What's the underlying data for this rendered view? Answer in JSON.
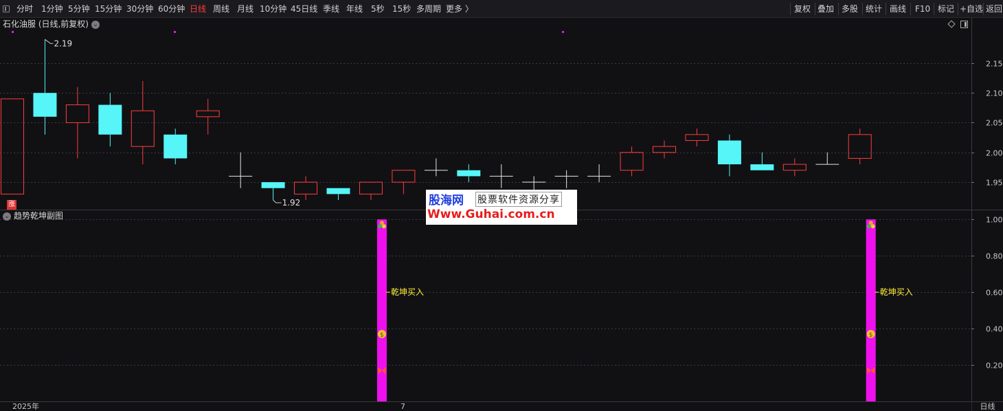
{
  "toolbar": {
    "periods": [
      "分时",
      "1分钟",
      "5分钟",
      "15分钟",
      "30分钟",
      "60分钟",
      "日线",
      "周线",
      "月线",
      "10分钟",
      "45日线",
      "季线",
      "年线",
      "5秒",
      "15秒",
      "多周期",
      "更多 〉"
    ],
    "active_period": "日线",
    "actions": [
      "复权",
      "叠加",
      "多股",
      "统计",
      "画线",
      "F10",
      "标记",
      "+自选",
      "返回"
    ]
  },
  "main_panel": {
    "title": "石化油服 (日线,前复权)",
    "high_label": "2.19",
    "low_label": "1.92",
    "zhang_badge": "涨",
    "y_axis_ticks": [
      "2.15",
      "2.10",
      "2.05",
      "2.00",
      "1.95"
    ]
  },
  "sub_panel": {
    "title": "趋势乾坤副图",
    "y_axis_ticks": [
      "1.00",
      "0.80",
      "0.60",
      "0.40",
      "0.20"
    ],
    "signal_label": "乾坤买入"
  },
  "watermark": {
    "brand": "股海网",
    "tagline": "股票软件资源分享",
    "url": "Www.Guhai.com.cn"
  },
  "bottom_axis": {
    "year_label": "2025年",
    "month_label": "7",
    "period_label": "日线"
  },
  "colors": {
    "up": "#ff3c3c",
    "down": "#55f5f8",
    "doji": "#e6e6e6",
    "signal_bar": "#ee11ee",
    "signal_text": "#ffee33",
    "grid": "#3a3a44"
  },
  "chart_data": {
    "type": "candlestick",
    "candles": [
      {
        "o": 1.93,
        "c": 2.09,
        "h": 2.09,
        "l": 1.93
      },
      {
        "o": 2.1,
        "c": 2.06,
        "h": 2.19,
        "l": 2.03
      },
      {
        "o": 2.05,
        "c": 2.08,
        "h": 2.11,
        "l": 1.99
      },
      {
        "o": 2.08,
        "c": 2.03,
        "h": 2.1,
        "l": 2.01
      },
      {
        "o": 2.01,
        "c": 2.07,
        "h": 2.12,
        "l": 1.98
      },
      {
        "o": 2.03,
        "c": 1.99,
        "h": 2.04,
        "l": 1.98
      },
      {
        "o": 2.06,
        "c": 2.07,
        "h": 2.09,
        "l": 2.03
      },
      {
        "o": 1.96,
        "c": 1.96,
        "h": 2.0,
        "l": 1.94
      },
      {
        "o": 1.95,
        "c": 1.94,
        "h": 1.95,
        "l": 1.92
      },
      {
        "o": 1.93,
        "c": 1.95,
        "h": 1.96,
        "l": 1.92
      },
      {
        "o": 1.94,
        "c": 1.93,
        "h": 1.94,
        "l": 1.92
      },
      {
        "o": 1.93,
        "c": 1.95,
        "h": 1.95,
        "l": 1.92
      },
      {
        "o": 1.95,
        "c": 1.97,
        "h": 1.97,
        "l": 1.93
      },
      {
        "o": 1.97,
        "c": 1.97,
        "h": 1.99,
        "l": 1.96
      },
      {
        "o": 1.97,
        "c": 1.96,
        "h": 1.98,
        "l": 1.95
      },
      {
        "o": 1.96,
        "c": 1.96,
        "h": 1.98,
        "l": 1.94
      },
      {
        "o": 1.95,
        "c": 1.95,
        "h": 1.96,
        "l": 1.93
      },
      {
        "o": 1.96,
        "c": 1.96,
        "h": 1.97,
        "l": 1.94
      },
      {
        "o": 1.96,
        "c": 1.96,
        "h": 1.98,
        "l": 1.95
      },
      {
        "o": 1.97,
        "c": 2.0,
        "h": 2.01,
        "l": 1.96
      },
      {
        "o": 2.0,
        "c": 2.01,
        "h": 2.02,
        "l": 1.99
      },
      {
        "o": 2.02,
        "c": 2.03,
        "h": 2.04,
        "l": 2.01
      },
      {
        "o": 2.02,
        "c": 1.98,
        "h": 2.03,
        "l": 1.96
      },
      {
        "o": 1.98,
        "c": 1.97,
        "h": 2.0,
        "l": 1.97
      },
      {
        "o": 1.97,
        "c": 1.98,
        "h": 1.99,
        "l": 1.96
      },
      {
        "o": 1.98,
        "c": 1.98,
        "h": 2.0,
        "l": 1.98
      },
      {
        "o": 1.99,
        "c": 2.03,
        "h": 2.04,
        "l": 1.98
      }
    ],
    "signals": [
      {
        "index": 11,
        "value": 1.0,
        "label": "乾坤买入"
      },
      {
        "index": 26,
        "value": 1.0,
        "label": "乾坤买入"
      }
    ],
    "main_ylim": [
      1.905,
      2.225
    ],
    "sub_ylim": [
      0,
      1.05
    ]
  }
}
